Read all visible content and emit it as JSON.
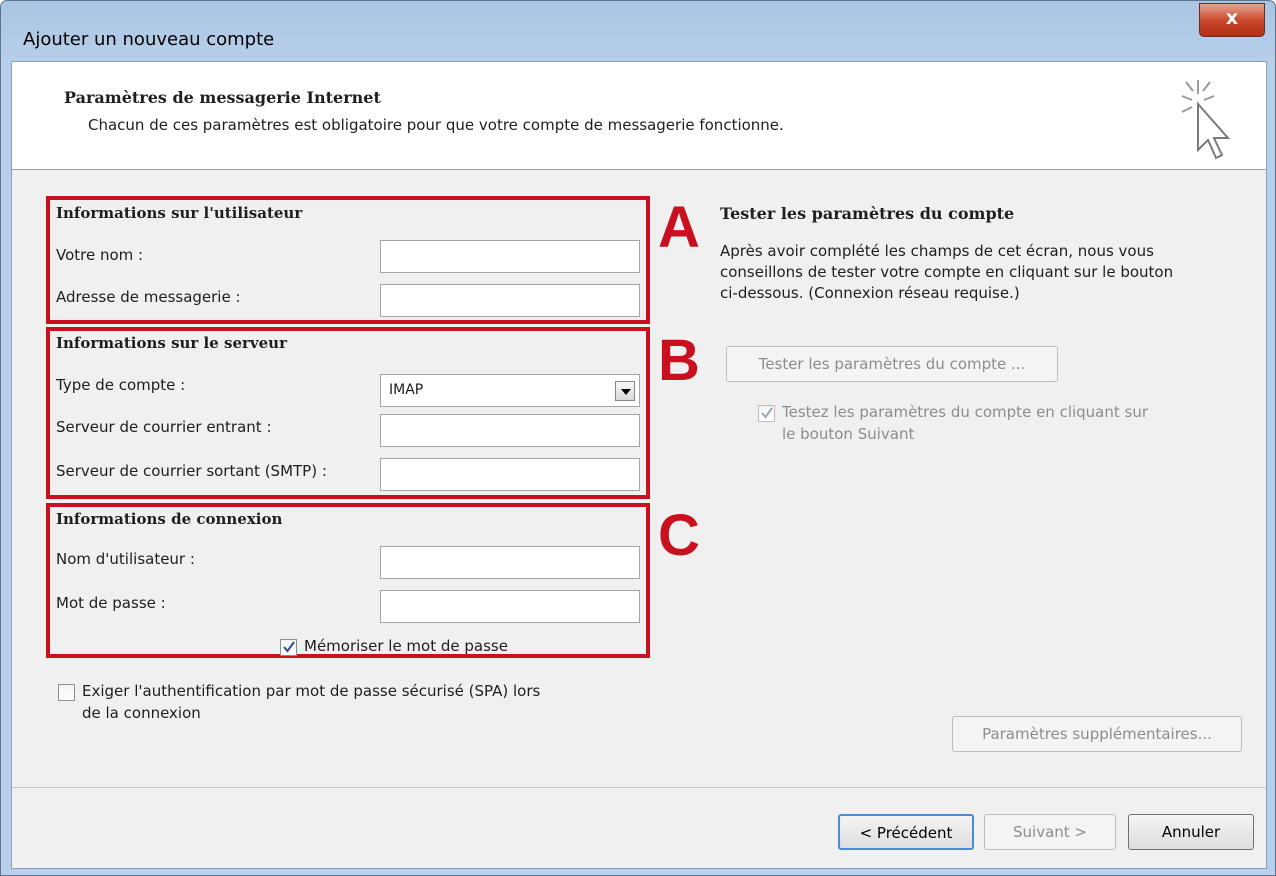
{
  "window": {
    "title": "Ajouter un nouveau compte",
    "close_glyph": "x"
  },
  "header": {
    "title": "Paramètres de messagerie Internet",
    "subtitle": "Chacun de ces paramètres est obligatoire pour que votre compte de messagerie fonctionne.",
    "icon": "cursor-click-icon"
  },
  "user_info": {
    "marker": "A",
    "title": "Informations sur l'utilisateur",
    "name_label": "Votre nom :",
    "name_value": "",
    "email_label": "Adresse de messagerie :",
    "email_value": ""
  },
  "server_info": {
    "marker": "B",
    "title": "Informations sur le serveur",
    "account_type_label": "Type de compte :",
    "account_type_value": "IMAP",
    "incoming_label": "Serveur de courrier entrant :",
    "incoming_value": "",
    "outgoing_label": "Serveur de courrier sortant (SMTP) :",
    "outgoing_value": ""
  },
  "logon_info": {
    "marker": "C",
    "title": "Informations de connexion",
    "username_label": "Nom d'utilisateur :",
    "username_value": "",
    "password_label": "Mot de passe :",
    "password_value": "",
    "remember_label": "Mémoriser le mot de passe",
    "remember_checked": true
  },
  "spa": {
    "label_line1": "Exiger l'authentification par mot de passe sécurisé (SPA) lors",
    "label_line2": "de la connexion",
    "checked": false
  },
  "test": {
    "title": "Tester les paramètres du compte",
    "desc_line1": "Après avoir complété les champs de cet écran, nous vous",
    "desc_line2": "conseillons de tester votre compte en cliquant sur le bouton",
    "desc_line3": "ci-dessous. (Connexion réseau requise.)",
    "button": "Tester les paramètres du compte ...",
    "auto_line1": "Testez les paramètres du compte en cliquant sur",
    "auto_line2": "le bouton Suivant",
    "auto_checked": true
  },
  "more_settings": "Paramètres supplémentaires...",
  "footer": {
    "back": "< Précédent",
    "next": "Suivant >",
    "cancel": "Annuler"
  },
  "colors": {
    "highlight": "#c8101e",
    "window_frame": "#b8cfe9"
  }
}
